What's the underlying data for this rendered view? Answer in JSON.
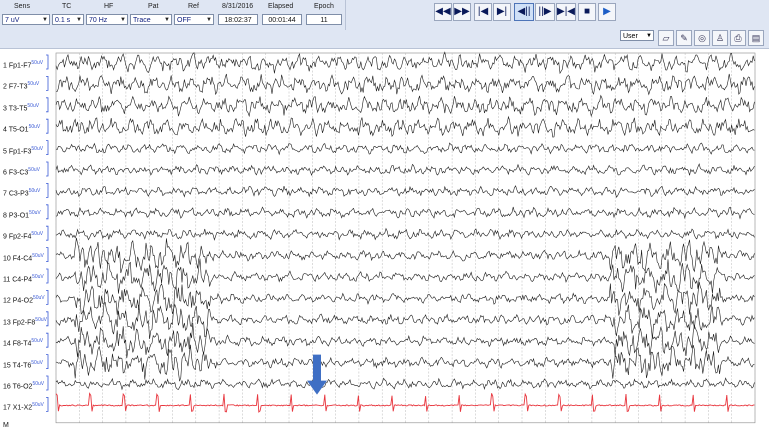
{
  "toolbar": {
    "sens": {
      "label": "Sens",
      "value": "7 uV"
    },
    "tc": {
      "label": "TC",
      "value": "0.1 s"
    },
    "hf": {
      "label": "HF",
      "value": "70 Hz"
    },
    "pat": {
      "label": "Pat",
      "value": "Trace"
    },
    "ref": {
      "label": "Ref",
      "value": "OFF"
    },
    "date": "8/31/2016",
    "clock": "18:02:37",
    "elapsed": {
      "label": "Elapsed",
      "value": "00:01:44"
    },
    "epoch": {
      "label": "Epoch",
      "value": "11"
    },
    "user": "User",
    "playback": [
      {
        "icon": "rewind-icon",
        "glyph": "◀◀"
      },
      {
        "icon": "fast-forward-icon",
        "glyph": "▶▶"
      },
      {
        "icon": "skip-start-icon",
        "glyph": "|◀"
      },
      {
        "icon": "skip-end-icon",
        "glyph": "▶|"
      },
      {
        "icon": "step-back-icon",
        "glyph": "◀||"
      },
      {
        "icon": "step-forward-icon",
        "glyph": "||▶"
      },
      {
        "icon": "seek-center-icon",
        "glyph": "▶|◀"
      },
      {
        "icon": "stop-icon",
        "glyph": "■"
      },
      {
        "icon": "play-icon",
        "glyph": "▶"
      }
    ],
    "tools": [
      "eraser-icon",
      "pen-icon",
      "target-icon",
      "person-icon",
      "print-icon",
      "print-setup-icon"
    ]
  },
  "gain_tag": "50uV",
  "channels": [
    {
      "label": "1  Fp1-F7"
    },
    {
      "label": "2  F7-T3"
    },
    {
      "label": "3  T3-T5"
    },
    {
      "label": "4  T5-O1"
    },
    {
      "label": "5  Fp1-F3"
    },
    {
      "label": "6  F3-C3"
    },
    {
      "label": "7  C3-P3"
    },
    {
      "label": "8  P3-O1"
    },
    {
      "label": "9  Fp2-F4"
    },
    {
      "label": "10  F4-C4"
    },
    {
      "label": "11  C4-P4"
    },
    {
      "label": "12  P4-O2"
    },
    {
      "label": "13  Fp2-F8"
    },
    {
      "label": "14  F8-T4"
    },
    {
      "label": "15  T4-T6"
    },
    {
      "label": "16  T6-O2"
    },
    {
      "label": "17  X1-X2"
    }
  ],
  "marker_channel": "M",
  "colors": {
    "ecg": "#e8373f",
    "grid": "#b8b8b8",
    "trace": "#1a1a1a",
    "arrow": "#3f6fc4",
    "gain": "#3b5bd6"
  }
}
